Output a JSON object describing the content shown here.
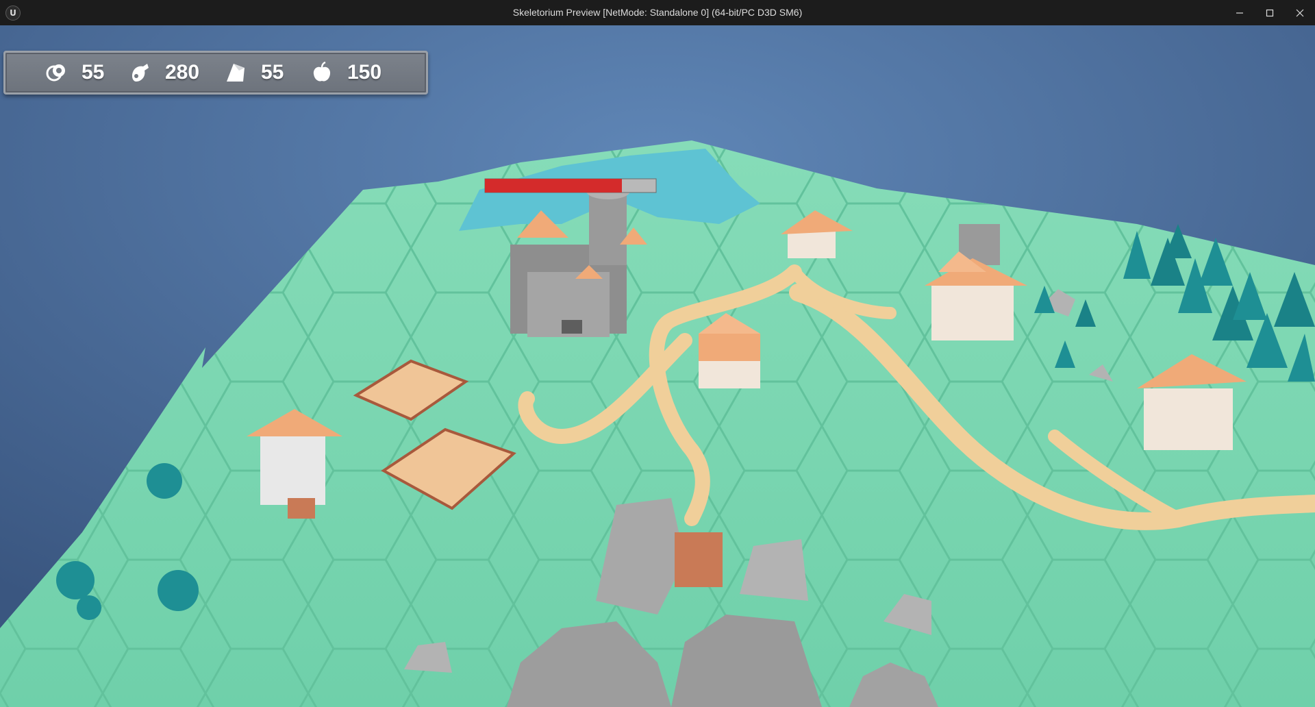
{
  "window": {
    "title": "Skeletorium Preview [NetMode: Standalone 0]  (64-bit/PC D3D SM6)",
    "logo_text": "U"
  },
  "hud": {
    "resources": [
      {
        "icon": "stone-icon",
        "value": "55"
      },
      {
        "icon": "wood-icon",
        "value": "280"
      },
      {
        "icon": "ore-icon",
        "value": "55"
      },
      {
        "icon": "food-icon",
        "value": "150"
      }
    ]
  },
  "castle_health": {
    "fraction": 0.8,
    "fill_color": "#d42b2b",
    "track_color": "#b9b9b9"
  },
  "colors": {
    "sky": "#5a7fae",
    "grass": "#7fd6b2",
    "water": "#5ec3d3",
    "path": "#f0cf9a",
    "rock": "#a8a8a8",
    "roof": "#f0aa78",
    "tree": "#1e8f94",
    "ui_panel": "#737982"
  }
}
